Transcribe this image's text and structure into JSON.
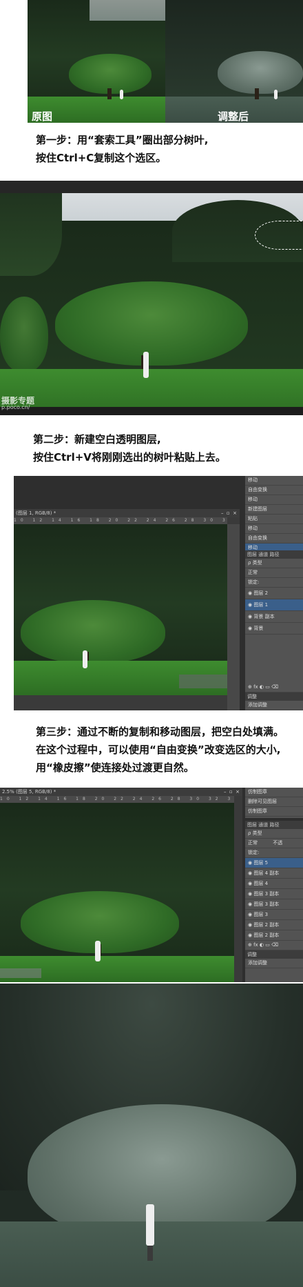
{
  "section1": {
    "label_left": "原图",
    "label_right": "调整后",
    "step_line1": "第一步：用“套索工具”圈出部分树叶,",
    "step_line2": "按住Ctrl+C复制这个选区。"
  },
  "section2": {
    "watermark_line1": "摄影专题",
    "watermark_line2": "p.poco.cn/"
  },
  "section3": {
    "step_line1": "第二步：新建空白透明图层,",
    "step_line2": "按住Ctrl+V将刚刚选出的树叶粘贴上去。",
    "doc_tab": "(图层 1, RGB/8) *",
    "ruler": "10 12 14 16 18 20 22 24 26 28 30 32 34 36",
    "history_items": [
      "移动",
      "自由变换",
      "移动",
      "新建图层",
      "粘贴",
      "移动",
      "自由变换",
      "移动"
    ],
    "layers_tabs": "图层  通道  路径",
    "filter_label": "ρ 类型",
    "blend_label": "正常",
    "lock_label": "锁定:",
    "layer_items": [
      "图层 2",
      "图层 1",
      "背景 副本",
      "背景"
    ],
    "adjust_label": "调整",
    "add_adjust_label": "添加调整"
  },
  "section4": {
    "step_line1": "第三步：通过不断的复制和移动图层，把空白处填满。",
    "step_line2": "在这个过程中，可以使用“自由变换”改变选区的大小,",
    "step_line3": "用“橡皮擦”使连接处过渡更自然。",
    "doc_tab": "2.5% (图层 5, RGB/8) *",
    "ruler": "10 12 14 16 18 20 22 24 26 28 30 32 34 36",
    "history_items": [
      "仿制图章",
      "删除可见图层",
      "仿制图章"
    ],
    "layers_tabs": "图层  通道  路径",
    "filter_label": "ρ 类型",
    "blend_label": "正常",
    "opacity_label": "不透",
    "lock_label": "锁定:",
    "layer_items": [
      "图层 5",
      "图层 4 副本",
      "图层 4",
      "图层 3 副本",
      "图层 3 副本",
      "图层 3",
      "图层 2 副本",
      "图层 2 副本"
    ],
    "adjust_label": "调整",
    "add_adjust_label": "添加调整"
  }
}
